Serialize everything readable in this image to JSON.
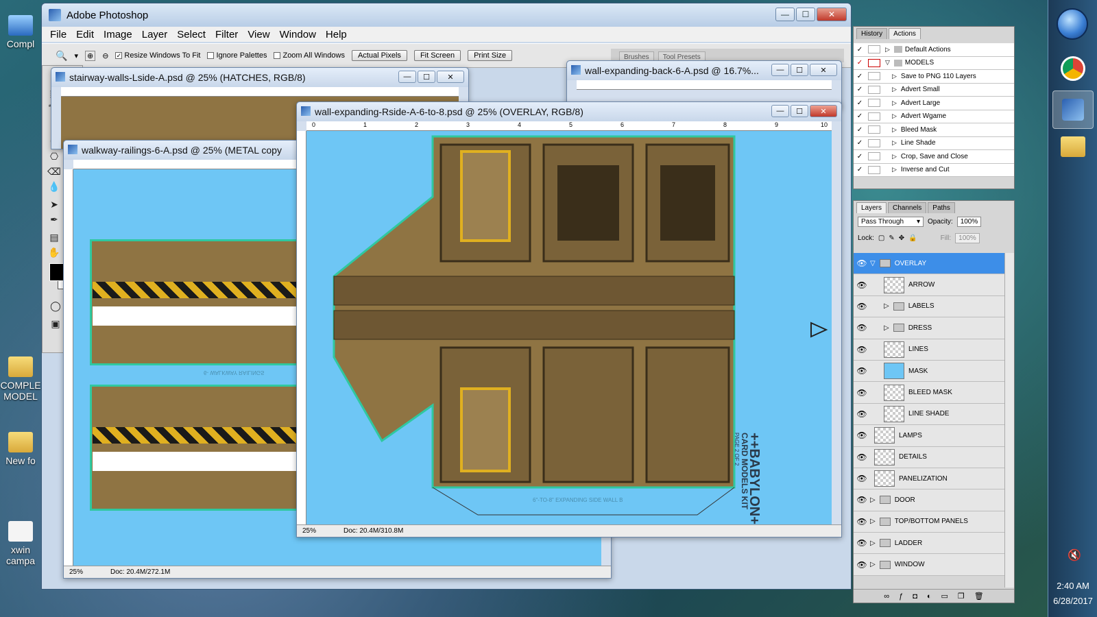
{
  "app": {
    "title": "Adobe Photoshop",
    "menu": [
      "File",
      "Edit",
      "Image",
      "Layer",
      "Select",
      "Filter",
      "View",
      "Window",
      "Help"
    ]
  },
  "options_bar": {
    "resize_windows": "Resize Windows To Fit",
    "ignore_palettes": "Ignore Palettes",
    "zoom_all": "Zoom All Windows",
    "actual_pixels": "Actual Pixels",
    "fit_screen": "Fit Screen",
    "print_size": "Print Size",
    "top_tabs": [
      "Brushes",
      "Tool Presets"
    ]
  },
  "documents": {
    "stairway": {
      "title": "stairway-walls-Lside-A.psd @ 25% (HATCHES, RGB/8)"
    },
    "walkway": {
      "title": "walkway-railings-6-A.psd @ 25% (METAL copy",
      "zoom": "25%",
      "doc": "Doc: 20.4M/272.1M",
      "footer": "6- WALKWAY RAILINGS"
    },
    "expanding_back": {
      "title": "wall-expanding-back-6-A.psd @ 16.7%..."
    },
    "expanding_rside": {
      "title": "wall-expanding-Rside-A-6-to-8.psd @ 25% (OVERLAY, RGB/8)",
      "zoom": "25%",
      "doc": "Doc: 20.4M/310.8M",
      "footer": "6\"-TO-8\" EXPANDING SIDE WALL B",
      "brand1": "++BABYLON++",
      "brand2": "CARD MODELS KIT",
      "page": "PAGE 2 OF 2",
      "ruler": [
        "0",
        "1",
        "2",
        "3",
        "4",
        "5",
        "6",
        "7",
        "8",
        "9",
        "10"
      ]
    }
  },
  "history_panel": {
    "tabs": [
      "History",
      "Actions"
    ],
    "items": [
      {
        "label": "Default Actions",
        "folder": true
      },
      {
        "label": "MODELS",
        "folder": true
      },
      {
        "label": "Save to PNG 110 Layers"
      },
      {
        "label": "Advert Small"
      },
      {
        "label": "Advert Large"
      },
      {
        "label": "Advert Wgame"
      },
      {
        "label": "Bleed Mask"
      },
      {
        "label": "Line Shade"
      },
      {
        "label": "Crop, Save and Close"
      },
      {
        "label": "Inverse and Cut"
      }
    ]
  },
  "layers_panel": {
    "tabs": [
      "Layers",
      "Channels",
      "Paths"
    ],
    "blend": "Pass Through",
    "opacity_label": "Opacity:",
    "opacity": "100%",
    "lock_label": "Lock:",
    "fill_label": "Fill:",
    "fill": "100%",
    "layers": [
      {
        "label": "OVERLAY",
        "type": "group",
        "selected": true
      },
      {
        "label": "ARROW",
        "type": "layer",
        "indent": true
      },
      {
        "label": "LABELS",
        "type": "group",
        "indent": true
      },
      {
        "label": "DRESS",
        "type": "group",
        "indent": true
      },
      {
        "label": "LINES",
        "type": "layer",
        "indent": true
      },
      {
        "label": "MASK",
        "type": "layer",
        "indent": true
      },
      {
        "label": "BLEED MASK",
        "type": "layer",
        "indent": true
      },
      {
        "label": "LINE SHADE",
        "type": "layer",
        "indent": true
      },
      {
        "label": "LAMPS",
        "type": "layer"
      },
      {
        "label": "DETAILS",
        "type": "layer"
      },
      {
        "label": "PANELIZATION",
        "type": "layer"
      },
      {
        "label": "DOOR",
        "type": "group"
      },
      {
        "label": "TOP/BOTTOM PANELS",
        "type": "group"
      },
      {
        "label": "LADDER",
        "type": "group"
      },
      {
        "label": "WINDOW",
        "type": "group"
      }
    ]
  },
  "desktop": {
    "icons": [
      "Compl",
      "COMPLE MODEL",
      "New fo",
      "xwin campa"
    ]
  },
  "tray": {
    "time": "2:40 AM",
    "date": "6/28/2017"
  },
  "colors": {
    "canvas": "#6ec6f5",
    "selection": "#3d8ee8",
    "metal": "#8f7443"
  }
}
